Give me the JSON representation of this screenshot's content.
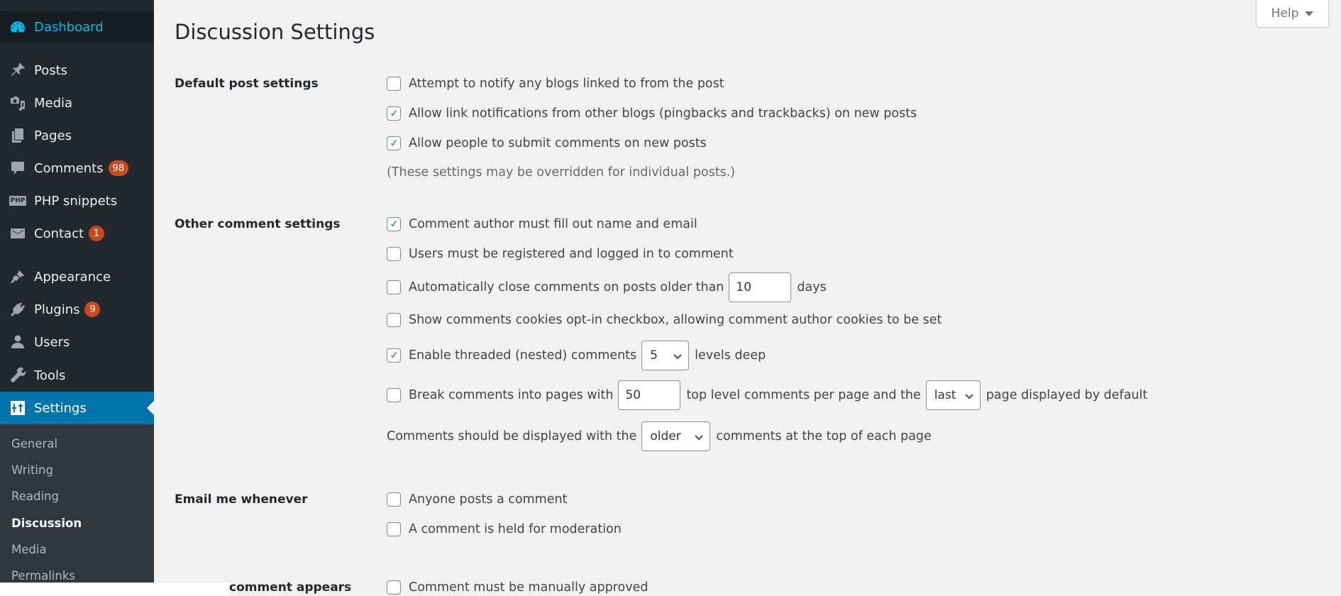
{
  "sidebar": {
    "items": [
      {
        "label": "Dashboard",
        "icon": "dashboard-icon"
      },
      {
        "label": "Posts",
        "icon": "pin-icon"
      },
      {
        "label": "Media",
        "icon": "media-icon"
      },
      {
        "label": "Pages",
        "icon": "pages-icon"
      },
      {
        "label": "Comments",
        "icon": "comment-icon",
        "badge": "98"
      },
      {
        "label": "PHP snippets",
        "icon": "php-icon"
      },
      {
        "label": "Contact",
        "icon": "mail-icon",
        "badge": "1"
      },
      {
        "label": "Appearance",
        "icon": "paintbrush-icon"
      },
      {
        "label": "Plugins",
        "icon": "plug-icon",
        "badge": "9"
      },
      {
        "label": "Users",
        "icon": "user-icon"
      },
      {
        "label": "Tools",
        "icon": "wrench-icon"
      },
      {
        "label": "Settings",
        "icon": "settings-icon",
        "active": true
      }
    ],
    "php_icon_text": "PHP",
    "submenu": [
      {
        "label": "General"
      },
      {
        "label": "Writing"
      },
      {
        "label": "Reading"
      },
      {
        "label": "Discussion",
        "current": true
      },
      {
        "label": "Media"
      },
      {
        "label": "Permalinks"
      }
    ]
  },
  "help": {
    "label": "Help"
  },
  "page": {
    "title": "Discussion Settings"
  },
  "sections": {
    "default_post": {
      "label": "Default post settings",
      "options": [
        {
          "label": "Attempt to notify any blogs linked to from the post",
          "checked": false
        },
        {
          "label": "Allow link notifications from other blogs (pingbacks and trackbacks) on new posts",
          "checked": true
        },
        {
          "label": "Allow people to submit comments on new posts",
          "checked": true
        }
      ],
      "note": "(These settings may be overridden for individual posts.)"
    },
    "other_comment": {
      "label": "Other comment settings",
      "author_fill": {
        "label": "Comment author must fill out name and email",
        "checked": true
      },
      "registered": {
        "label": "Users must be registered and logged in to comment",
        "checked": false
      },
      "auto_close": {
        "label_before": "Automatically close comments on posts older than",
        "value": "10",
        "label_after": "days",
        "checked": false
      },
      "cookies": {
        "label": "Show comments cookies opt-in checkbox, allowing comment author cookies to be set",
        "checked": false
      },
      "threaded": {
        "label_before": "Enable threaded (nested) comments",
        "value": "5",
        "label_after": "levels deep",
        "checked": true
      },
      "paging": {
        "label_before": "Break comments into pages with",
        "value": "50",
        "label_middle": "top level comments per page and the",
        "page_select": "last",
        "label_after": "page displayed by default",
        "checked": false
      },
      "order": {
        "label_before": "Comments should be displayed with the",
        "value": "older",
        "label_after": "comments at the top of each page"
      }
    },
    "email": {
      "label": "Email me whenever",
      "options": [
        {
          "label": "Anyone posts a comment",
          "checked": false
        },
        {
          "label": "A comment is held for moderation",
          "checked": false
        }
      ]
    },
    "before_appears": {
      "label": "comment appears",
      "options": [
        {
          "label": "Comment must be manually approved",
          "checked": false
        }
      ]
    }
  }
}
